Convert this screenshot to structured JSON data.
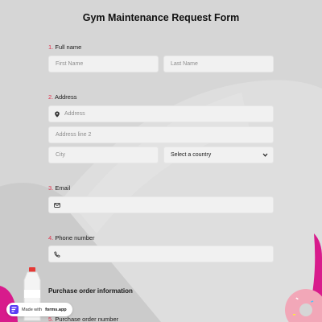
{
  "form": {
    "title": "Gym Maintenance Request Form",
    "questions": [
      {
        "number": "1.",
        "label": "Full name",
        "fields": {
          "first_placeholder": "First Name",
          "last_placeholder": "Last Name"
        }
      },
      {
        "number": "2.",
        "label": "Address",
        "fields": {
          "address_placeholder": "Address",
          "address2_placeholder": "Address line 2",
          "city_placeholder": "City",
          "country_value": "Select a country"
        }
      },
      {
        "number": "3.",
        "label": "Email"
      },
      {
        "number": "4.",
        "label": "Phone number"
      }
    ],
    "section_heading": "Purchase order information",
    "next_question": {
      "number": "5.",
      "label": "Purchase order number"
    }
  },
  "icons": {
    "address": "location-pin-icon",
    "email": "envelope-icon",
    "phone": "phone-icon",
    "select": "chevron-down-icon"
  },
  "badge": {
    "prefix": "Made with",
    "brand": "forms.app"
  },
  "colors": {
    "background": "#d6d6d6",
    "field": "#f1f1f1",
    "accent_number": "#e0334e",
    "decor_magenta": "#d81b8c"
  }
}
